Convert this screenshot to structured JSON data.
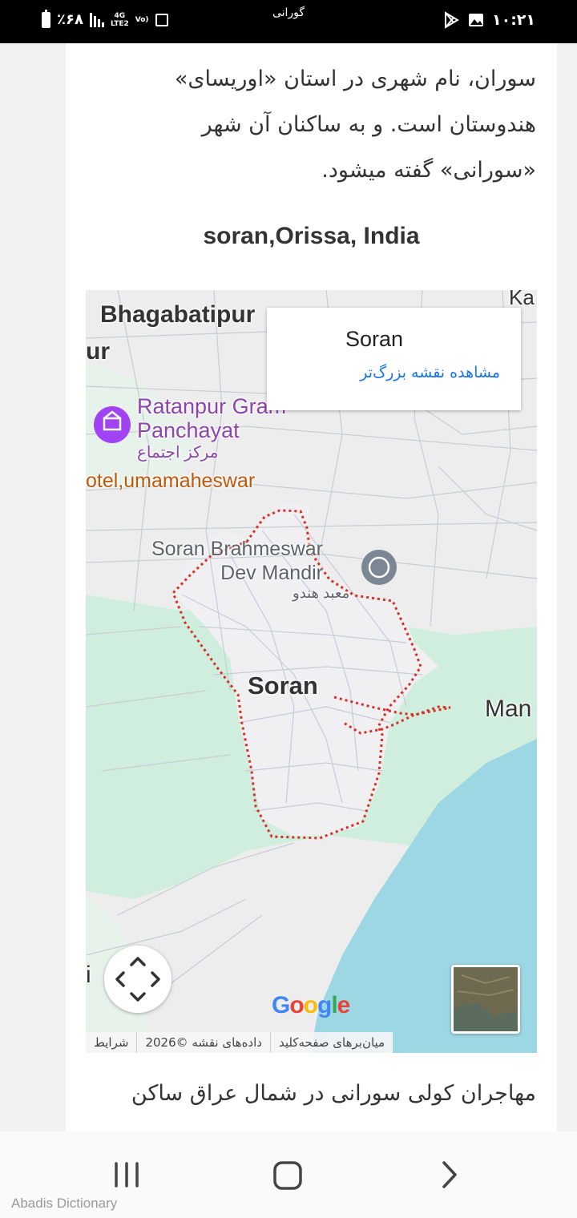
{
  "status_bar": {
    "battery": "٪۶۸",
    "network_top": "4G",
    "network_bottom": "LTE2",
    "volte_top": "Vo)",
    "app_title": "گورانی",
    "time": "۱۰:۲۱"
  },
  "article": {
    "paragraph1_line1": "سوران، نام شهری در استان «اوریسای»",
    "paragraph1_line2": "هندوستان است. و به ساکنان آن شهر",
    "paragraph1_line3": "«سورانی» گفته میشود.",
    "heading": "soran,Orissa, India",
    "paragraph2_line1": "مهاجران کولی سورانی در شمال عراق ساکن"
  },
  "map": {
    "labels": {
      "bhagabatipur": "Bhagabatipur",
      "ur": "ur",
      "ka": "Ka",
      "ratanpur_line1": "Ratanpur Gram",
      "ratanpur_line2": "Panchayat",
      "community_center": "مرکز اجتماع",
      "hotel": "otel,umamaheswar",
      "temple_line1": "Soran Brahmeswar",
      "temple_line2": "Dev Mandir",
      "temple_type": "معبد هندو",
      "soran": "Soran",
      "man": "Man",
      "i": "i"
    },
    "info_card": {
      "title": "Soran",
      "link": "مشاهده نقشه بزرگ‌تر"
    },
    "google_logo": "Google",
    "attribution": {
      "shortcuts": "میان‌برهای صفحه‌کلید",
      "data": "داده‌های نقشه ©2026",
      "terms": "شرایط"
    },
    "colors": {
      "water": "#9ed7e4",
      "green": "#cfeedd",
      "land": "#ededed",
      "boundary": "#d93025"
    }
  },
  "bottom_nav": {
    "footer_label": "Abadis Dictionary"
  }
}
